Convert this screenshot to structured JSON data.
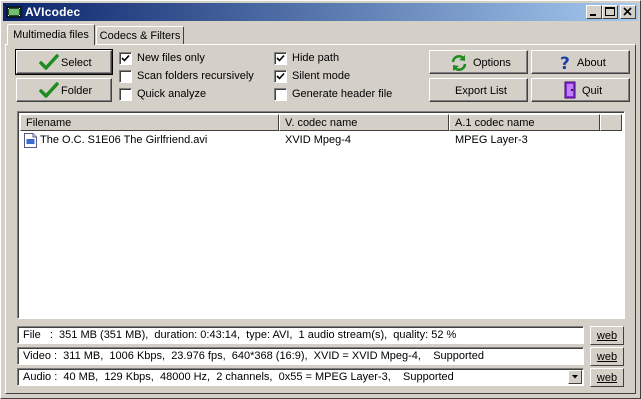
{
  "window": {
    "title": "AVIcodec"
  },
  "tabs": [
    {
      "label": "Multimedia files",
      "active": true
    },
    {
      "label": "Codecs & Filters",
      "active": false
    }
  ],
  "buttons": {
    "select": "Select",
    "folder": "Folder",
    "options": "Options",
    "about": "About",
    "export_list": "Export List",
    "quit": "Quit"
  },
  "checkboxes": [
    {
      "label": "New files only",
      "checked": true
    },
    {
      "label": "Scan folders recursively",
      "checked": false
    },
    {
      "label": "Quick analyze",
      "checked": false
    },
    {
      "label": "Hide path",
      "checked": true
    },
    {
      "label": "Silent mode",
      "checked": true
    },
    {
      "label": "Generate header file",
      "checked": false
    }
  ],
  "list": {
    "columns": [
      "Filename",
      "V. codec name",
      "A.1 codec name"
    ],
    "rows": [
      {
        "filename": "The O.C. S1E06 The Girlfriend.avi",
        "vcodec": "XVID Mpeg-4",
        "acodec": "MPEG Layer-3"
      }
    ]
  },
  "info": {
    "file": "File   :  351 MB (351 MB),  duration: 0:43:14,  type: AVI,  1 audio stream(s),  quality: 52 %",
    "video": "Video :  311 MB,  1006 Kbps,  23.976 fps,  640*368 (16:9),  XVID = XVID Mpeg-4,    Supported",
    "audio": "Audio :  40 MB,  129 Kbps,  48000 Hz,  2 channels,  0x55 = MPEG Layer-3,    Supported",
    "web_label": "web"
  },
  "icons": {
    "app": "film-icon",
    "select": "green-check-icon",
    "folder": "green-check-icon",
    "options": "refresh-arrows-icon",
    "about": "question-mark-icon",
    "quit": "exit-door-icon",
    "file_row": "video-file-icon"
  },
  "colors": {
    "titlebar_start": "#0a246a",
    "titlebar_end": "#a6caf0",
    "face": "#d4d0c8"
  }
}
